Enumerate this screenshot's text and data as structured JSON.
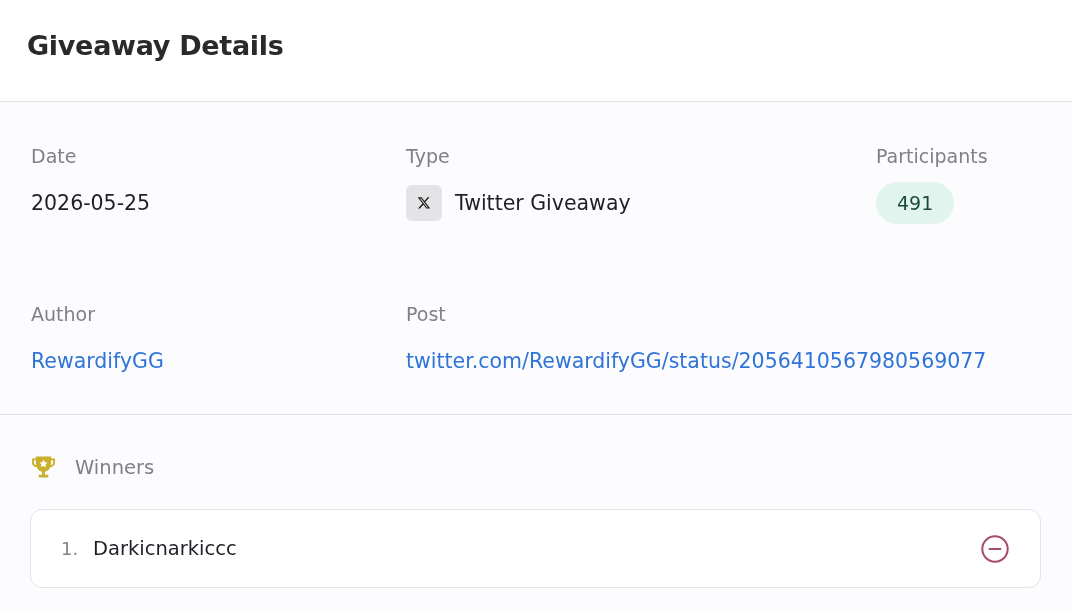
{
  "header": {
    "title": "Giveaway Details"
  },
  "details": {
    "rows": [
      [
        {
          "kind": "text",
          "label": "Date",
          "value": "2026-05-25"
        },
        {
          "kind": "platform",
          "label": "Type",
          "value": "Twitter Giveaway"
        },
        {
          "kind": "badge",
          "label": "Participants",
          "value": "491"
        }
      ],
      [
        {
          "kind": "link",
          "label": "Author",
          "value": "RewardifyGG"
        },
        {
          "kind": "link",
          "label": "Post",
          "value": "twitter.com/RewardifyGG/status/2056410567980569077"
        }
      ]
    ]
  },
  "winners": {
    "title": "Winners",
    "items": [
      {
        "rank": "1.",
        "name": "Darkicnarkiccc"
      }
    ]
  }
}
